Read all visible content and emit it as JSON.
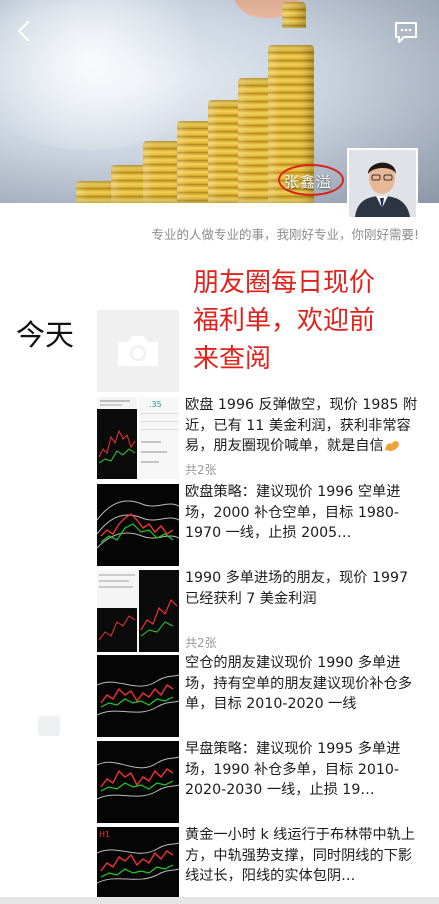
{
  "profile": {
    "name": "张鑫溢",
    "signature": "专业的人做专业的事，我刚好专业，你刚好需要!"
  },
  "promo": {
    "line1": "朋友圈每日现价",
    "line2": "福利单，欢迎前",
    "line3": "来查阅"
  },
  "feed": {
    "date_label": "今天",
    "posts": [
      {
        "text": "欧盘 1996 反弹做空，现价 1985 附近，已有 11 美金利润，获利非常容易，朋友圈现价喊单，就是自信",
        "image_count": "共2张"
      },
      {
        "text": "欧盘策略：建议现价 1996 空单进场，2000 补仓空单，目标 1980-1970 一线，止损 2005…",
        "image_count": ""
      },
      {
        "text": "1990 多单进场的朋友，现价 1997 已经获利 7 美金利润",
        "image_count": "共2张"
      },
      {
        "text": "空仓的朋友建议现价 1990 多单进场，持有空单的朋友建议现价补仓多单，目标 2010-2020 一线",
        "image_count": ""
      },
      {
        "text": "早盘策略：建议现价 1995 多单进场，1990 补仓多单，目标 2010-2020-2030 一线，止损 19…",
        "image_count": ""
      },
      {
        "text": "黄金一小时 k 线运行于布林带中轨上方，中轨强势支撑，同时阴线的下影线过长，阳线的实体包阴…",
        "image_count": ""
      }
    ]
  },
  "icons": {
    "back": "back-chevron-icon",
    "comment": "message-icon",
    "camera": "camera-icon",
    "emoji": "muscle-emoji-icon"
  },
  "colors": {
    "promo_red": "#e0221a",
    "gold": "#e4b83a"
  }
}
